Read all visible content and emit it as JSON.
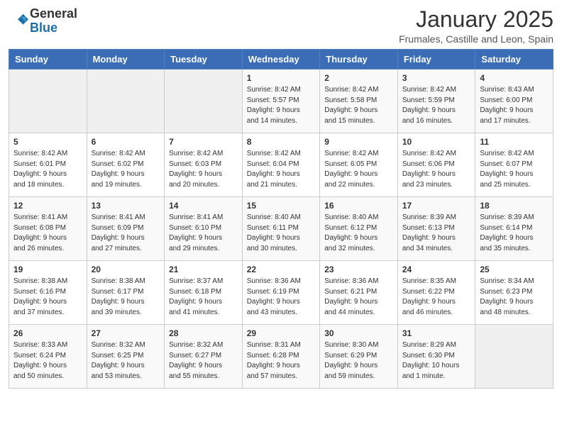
{
  "header": {
    "logo_general": "General",
    "logo_blue": "Blue",
    "month_title": "January 2025",
    "location": "Frumales, Castille and Leon, Spain"
  },
  "weekdays": [
    "Sunday",
    "Monday",
    "Tuesday",
    "Wednesday",
    "Thursday",
    "Friday",
    "Saturday"
  ],
  "weeks": [
    [
      {
        "num": "",
        "info": ""
      },
      {
        "num": "",
        "info": ""
      },
      {
        "num": "",
        "info": ""
      },
      {
        "num": "1",
        "info": "Sunrise: 8:42 AM\nSunset: 5:57 PM\nDaylight: 9 hours\nand 14 minutes."
      },
      {
        "num": "2",
        "info": "Sunrise: 8:42 AM\nSunset: 5:58 PM\nDaylight: 9 hours\nand 15 minutes."
      },
      {
        "num": "3",
        "info": "Sunrise: 8:42 AM\nSunset: 5:59 PM\nDaylight: 9 hours\nand 16 minutes."
      },
      {
        "num": "4",
        "info": "Sunrise: 8:43 AM\nSunset: 6:00 PM\nDaylight: 9 hours\nand 17 minutes."
      }
    ],
    [
      {
        "num": "5",
        "info": "Sunrise: 8:42 AM\nSunset: 6:01 PM\nDaylight: 9 hours\nand 18 minutes."
      },
      {
        "num": "6",
        "info": "Sunrise: 8:42 AM\nSunset: 6:02 PM\nDaylight: 9 hours\nand 19 minutes."
      },
      {
        "num": "7",
        "info": "Sunrise: 8:42 AM\nSunset: 6:03 PM\nDaylight: 9 hours\nand 20 minutes."
      },
      {
        "num": "8",
        "info": "Sunrise: 8:42 AM\nSunset: 6:04 PM\nDaylight: 9 hours\nand 21 minutes."
      },
      {
        "num": "9",
        "info": "Sunrise: 8:42 AM\nSunset: 6:05 PM\nDaylight: 9 hours\nand 22 minutes."
      },
      {
        "num": "10",
        "info": "Sunrise: 8:42 AM\nSunset: 6:06 PM\nDaylight: 9 hours\nand 23 minutes."
      },
      {
        "num": "11",
        "info": "Sunrise: 8:42 AM\nSunset: 6:07 PM\nDaylight: 9 hours\nand 25 minutes."
      }
    ],
    [
      {
        "num": "12",
        "info": "Sunrise: 8:41 AM\nSunset: 6:08 PM\nDaylight: 9 hours\nand 26 minutes."
      },
      {
        "num": "13",
        "info": "Sunrise: 8:41 AM\nSunset: 6:09 PM\nDaylight: 9 hours\nand 27 minutes."
      },
      {
        "num": "14",
        "info": "Sunrise: 8:41 AM\nSunset: 6:10 PM\nDaylight: 9 hours\nand 29 minutes."
      },
      {
        "num": "15",
        "info": "Sunrise: 8:40 AM\nSunset: 6:11 PM\nDaylight: 9 hours\nand 30 minutes."
      },
      {
        "num": "16",
        "info": "Sunrise: 8:40 AM\nSunset: 6:12 PM\nDaylight: 9 hours\nand 32 minutes."
      },
      {
        "num": "17",
        "info": "Sunrise: 8:39 AM\nSunset: 6:13 PM\nDaylight: 9 hours\nand 34 minutes."
      },
      {
        "num": "18",
        "info": "Sunrise: 8:39 AM\nSunset: 6:14 PM\nDaylight: 9 hours\nand 35 minutes."
      }
    ],
    [
      {
        "num": "19",
        "info": "Sunrise: 8:38 AM\nSunset: 6:16 PM\nDaylight: 9 hours\nand 37 minutes."
      },
      {
        "num": "20",
        "info": "Sunrise: 8:38 AM\nSunset: 6:17 PM\nDaylight: 9 hours\nand 39 minutes."
      },
      {
        "num": "21",
        "info": "Sunrise: 8:37 AM\nSunset: 6:18 PM\nDaylight: 9 hours\nand 41 minutes."
      },
      {
        "num": "22",
        "info": "Sunrise: 8:36 AM\nSunset: 6:19 PM\nDaylight: 9 hours\nand 43 minutes."
      },
      {
        "num": "23",
        "info": "Sunrise: 8:36 AM\nSunset: 6:21 PM\nDaylight: 9 hours\nand 44 minutes."
      },
      {
        "num": "24",
        "info": "Sunrise: 8:35 AM\nSunset: 6:22 PM\nDaylight: 9 hours\nand 46 minutes."
      },
      {
        "num": "25",
        "info": "Sunrise: 8:34 AM\nSunset: 6:23 PM\nDaylight: 9 hours\nand 48 minutes."
      }
    ],
    [
      {
        "num": "26",
        "info": "Sunrise: 8:33 AM\nSunset: 6:24 PM\nDaylight: 9 hours\nand 50 minutes."
      },
      {
        "num": "27",
        "info": "Sunrise: 8:32 AM\nSunset: 6:25 PM\nDaylight: 9 hours\nand 53 minutes."
      },
      {
        "num": "28",
        "info": "Sunrise: 8:32 AM\nSunset: 6:27 PM\nDaylight: 9 hours\nand 55 minutes."
      },
      {
        "num": "29",
        "info": "Sunrise: 8:31 AM\nSunset: 6:28 PM\nDaylight: 9 hours\nand 57 minutes."
      },
      {
        "num": "30",
        "info": "Sunrise: 8:30 AM\nSunset: 6:29 PM\nDaylight: 9 hours\nand 59 minutes."
      },
      {
        "num": "31",
        "info": "Sunrise: 8:29 AM\nSunset: 6:30 PM\nDaylight: 10 hours\nand 1 minute."
      },
      {
        "num": "",
        "info": ""
      }
    ]
  ]
}
